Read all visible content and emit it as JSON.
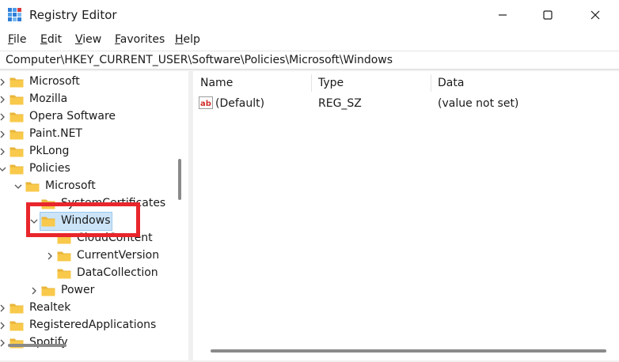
{
  "window": {
    "title": "Registry Editor"
  },
  "menu": [
    {
      "label": "File",
      "key": "F",
      "rest": "ile"
    },
    {
      "label": "Edit",
      "key": "E",
      "rest": "dit"
    },
    {
      "label": "View",
      "key": "V",
      "rest": "iew"
    },
    {
      "label": "Favorites",
      "key": "F",
      "rest": "avorites"
    },
    {
      "label": "Help",
      "key": "H",
      "rest": "elp"
    }
  ],
  "address": {
    "path": "Computer\\HKEY_CURRENT_USER\\Software\\Policies\\Microsoft\\Windows"
  },
  "tree": [
    {
      "label": "Microsoft",
      "expander": "collapsed"
    },
    {
      "label": "Mozilla",
      "expander": "collapsed"
    },
    {
      "label": "Opera Software",
      "expander": "collapsed"
    },
    {
      "label": "Paint.NET",
      "expander": "collapsed"
    },
    {
      "label": "PkLong",
      "expander": "collapsed"
    },
    {
      "label": "Policies",
      "expander": "expanded"
    },
    {
      "label": "Microsoft",
      "expander": "expanded"
    },
    {
      "label": "SystemCertificates",
      "expander": "none"
    },
    {
      "label": "Windows",
      "expander": "expanded",
      "selected": true
    },
    {
      "label": "CloudContent",
      "expander": "none"
    },
    {
      "label": "CurrentVersion",
      "expander": "collapsed"
    },
    {
      "label": "DataCollection",
      "expander": "none"
    },
    {
      "label": "Power",
      "expander": "collapsed"
    },
    {
      "label": "Realtek",
      "expander": "collapsed"
    },
    {
      "label": "RegisteredApplications",
      "expander": "collapsed"
    },
    {
      "label": "Spotify",
      "expander": "collapsed"
    }
  ],
  "list": {
    "columns": [
      "Name",
      "Type",
      "Data"
    ],
    "rows": [
      {
        "name": "(Default)",
        "type": "REG_SZ",
        "data": "(value not set)",
        "icon": "string-value-icon"
      }
    ]
  },
  "colors": {
    "selection": "#cce4f7",
    "highlight_box": "#e8262b",
    "folder": "#f8c94a"
  }
}
